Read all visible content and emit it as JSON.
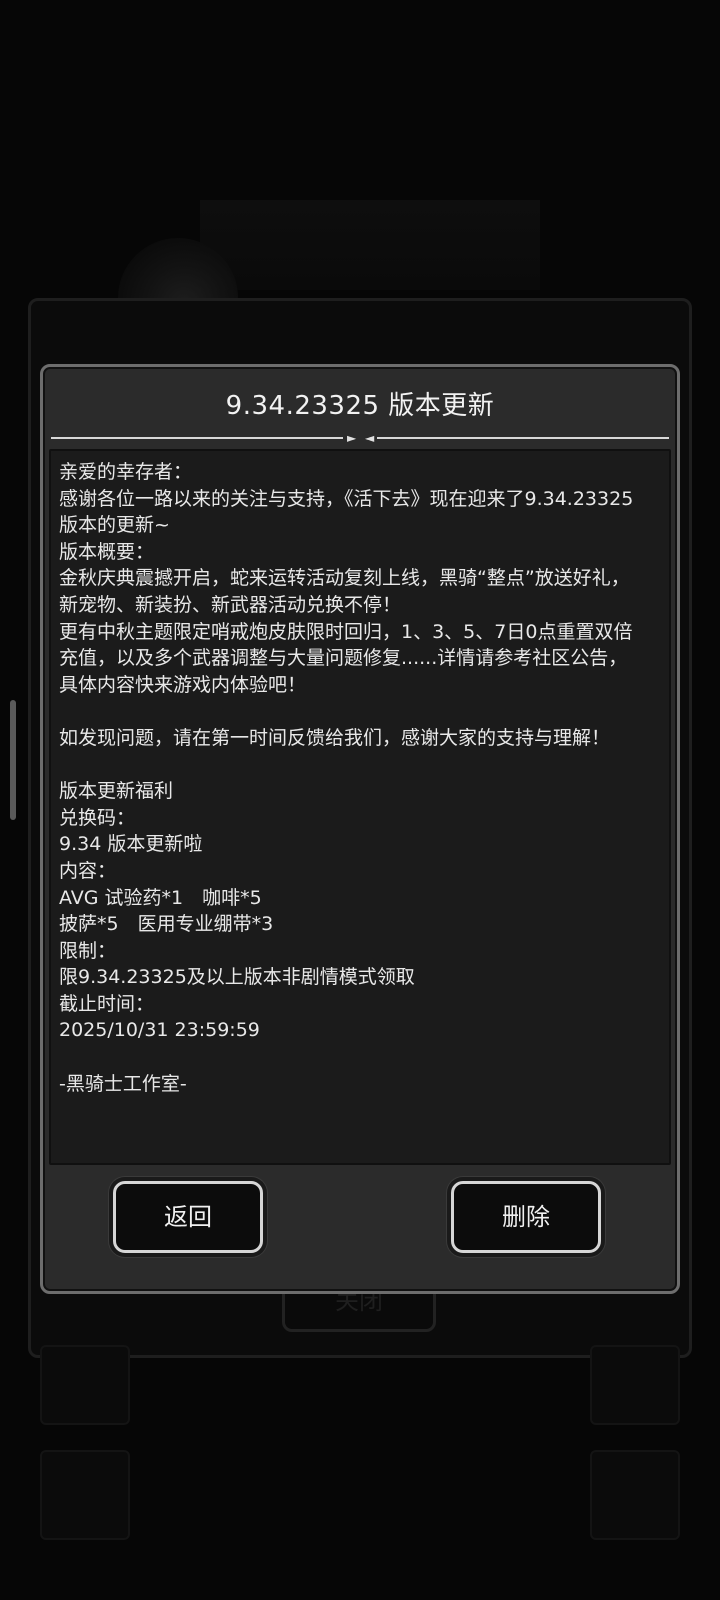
{
  "dialog": {
    "title": "9.34.23325 版本更新",
    "lines": [
      "亲爱的幸存者：",
      "感谢各位一路以来的关注与支持，《活下去》现在迎来了9.34.23325",
      "版本的更新~",
      "版本概要：",
      "金秋庆典震撼开启，蛇来运转活动复刻上线，黑骑“整点”放送好礼，",
      "新宠物、新装扮、新武器活动兑换不停！",
      "更有中秋主题限定哨戒炮皮肤限时回归，1、3、5、7日0点重置双倍",
      "充值，以及多个武器调整与大量问题修复......详情请参考社区公告，",
      "具体内容快来游戏内体验吧！",
      "",
      "如发现问题，请在第一时间反馈给我们，感谢大家的支持与理解！",
      "",
      "版本更新福利",
      "兑换码：",
      "9.34 版本更新啦",
      "内容：",
      "AVG 试验药*1　咖啡*5",
      "披萨*5　医用专业绷带*3",
      "限制：",
      "限9.34.23325及以上版本非剧情模式领取",
      "截止时间：",
      "2025/10/31 23:59:59",
      "",
      "-黑骑士工作室-"
    ],
    "back_label": "返回",
    "delete_label": "删除"
  },
  "background": {
    "button_label": "关闭"
  }
}
